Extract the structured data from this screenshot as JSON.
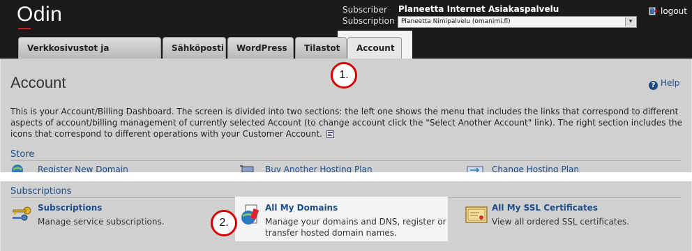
{
  "app": {
    "logo": "Odin"
  },
  "header": {
    "subscriber_label": "Subscriber",
    "subscriber_value": "Planeetta Internet Asiakaspalvelu",
    "subscription_label": "Subscription",
    "subscription_value": "Planeetta Nimipalvelu (omanimi.fi)",
    "logout_label": "logout"
  },
  "tabs": [
    {
      "label": "Verkkosivustot ja toimialueet",
      "active": false
    },
    {
      "label": "Sähköposti",
      "active": false
    },
    {
      "label": "WordPress",
      "active": false
    },
    {
      "label": "Tilastot",
      "active": false
    },
    {
      "label": "Account",
      "active": true
    }
  ],
  "page": {
    "title": "Account",
    "help_label": "Help",
    "description": "This is your Account/Billing Dashboard. The screen is divided into two sections: the left one shows the menu that includes the links that correspond to different aspects of account/billing management of currently selected Account (to change account click the \"Select Another Account\" link). The right section includes the icons that correspond to different operations with your Customer Account."
  },
  "store": {
    "title": "Store",
    "links": [
      {
        "label": "Register New Domain",
        "icon": "globe-icon"
      },
      {
        "label": "Buy Another Hosting Plan",
        "icon": "cart-icon"
      },
      {
        "label": "Change Hosting Plan",
        "icon": "swap-icon"
      }
    ]
  },
  "subscriptions": {
    "title": "Subscriptions",
    "items": [
      {
        "title": "Subscriptions",
        "desc_lines": [
          "Manage service subscriptions."
        ],
        "icon": "keys-icon"
      },
      {
        "title": "All My Domains",
        "desc_lines": [
          "Manage your domains and DNS, register or",
          "transfer hosted domain names."
        ],
        "icon": "domains-icon"
      },
      {
        "title": "All My SSL Certificates",
        "desc_lines": [
          "View all ordered SSL certificates."
        ],
        "icon": "certificate-icon"
      }
    ]
  },
  "callouts": [
    "1.",
    "2."
  ],
  "colors": {
    "link": "#1d4d87",
    "header_bg": "#1b1b1b",
    "callout_ring": "#d40000"
  }
}
